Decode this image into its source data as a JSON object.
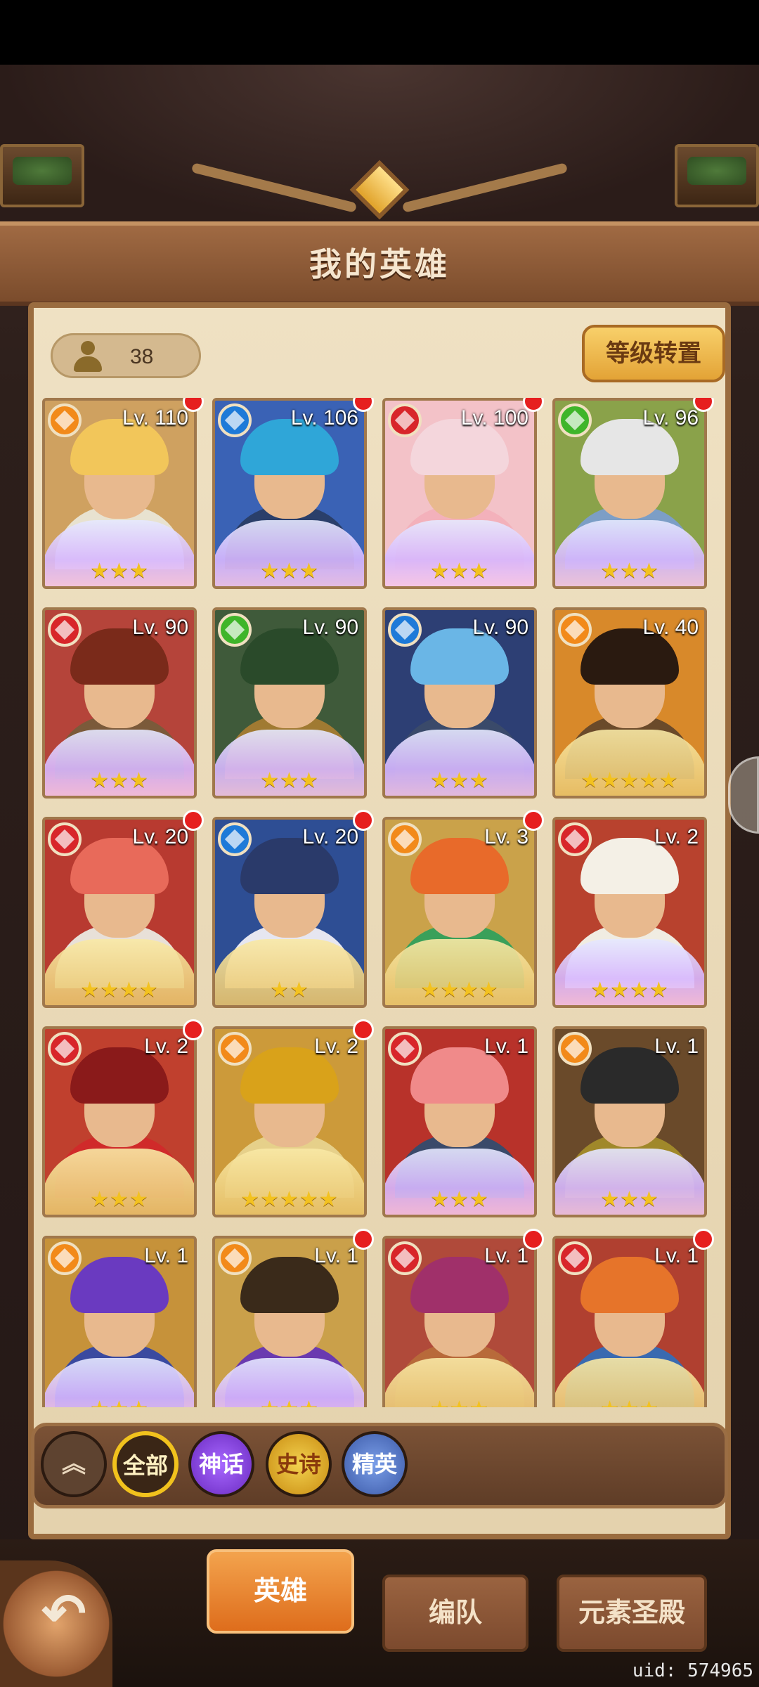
{
  "header": {
    "title": "我的英雄"
  },
  "hero_count": "38",
  "reset_button": "等级转置",
  "colors": {
    "fire": "#d8262a",
    "water": "#1e7ad8",
    "earth": "#f28a1a",
    "wind": "#3fb52a",
    "red_dot": "#e61f1f"
  },
  "heroes": [
    {
      "level": "Lv. 110",
      "stars": "★★★",
      "element": "earth",
      "dot": true,
      "frame": "wings",
      "bg": "#cfa160",
      "hair": "#f2c65a",
      "cloth": "#e8e2d0"
    },
    {
      "level": "Lv. 106",
      "stars": "★★★",
      "element": "water",
      "dot": true,
      "frame": "wings",
      "bg": "#3a62b5",
      "hair": "#2fa6d8",
      "cloth": "#2a3f6a"
    },
    {
      "level": "Lv. 100",
      "stars": "★★★",
      "element": "fire",
      "dot": true,
      "frame": "wings",
      "bg": "#f3c2c8",
      "hair": "#f4d6dc",
      "cloth": "#f3b1bb"
    },
    {
      "level": "Lv. 96",
      "stars": "★★★",
      "element": "wind",
      "dot": true,
      "frame": "wings",
      "bg": "#8aa24a",
      "hair": "#e6e6e6",
      "cloth": "#7c9ec6"
    },
    {
      "level": "Lv. 90",
      "stars": "★★★",
      "element": "fire",
      "dot": false,
      "frame": "wings",
      "bg": "#b5443a",
      "hair": "#7a2a1a",
      "cloth": "#7b5a3a"
    },
    {
      "level": "Lv. 90",
      "stars": "★★★",
      "element": "wind",
      "dot": false,
      "frame": "wings",
      "bg": "#3f5a3a",
      "hair": "#2a4a2a",
      "cloth": "#a07a32"
    },
    {
      "level": "Lv. 90",
      "stars": "★★★",
      "element": "water",
      "dot": false,
      "frame": "wings",
      "bg": "#2d3f74",
      "hair": "#6ab6e6",
      "cloth": "#3a4a6a"
    },
    {
      "level": "Lv. 40",
      "stars": "★★★★★",
      "element": "earth",
      "dot": false,
      "frame": "gold",
      "bg": "#d8892a",
      "hair": "#2a1a10",
      "cloth": "#6a4a2a"
    },
    {
      "level": "Lv. 20",
      "stars": "★★★★",
      "element": "fire",
      "dot": true,
      "frame": "gold",
      "bg": "#b83a30",
      "hair": "#e86a5a",
      "cloth": "#e8e0d8"
    },
    {
      "level": "Lv. 20",
      "stars": "★★",
      "element": "water",
      "dot": true,
      "frame": "gold",
      "bg": "#2e4e94",
      "hair": "#2a3a6a",
      "cloth": "#e6e6f0"
    },
    {
      "level": "Lv. 3",
      "stars": "★★★★",
      "element": "earth",
      "dot": true,
      "frame": "gold",
      "bg": "#caa24a",
      "hair": "#e86a2a",
      "cloth": "#3aa05a"
    },
    {
      "level": "Lv. 2",
      "stars": "★★★★",
      "element": "fire",
      "dot": false,
      "frame": "wings",
      "bg": "#b8422e",
      "hair": "#f4f0e6",
      "cloth": "#f0ece2"
    },
    {
      "level": "Lv. 2",
      "stars": "★★★",
      "element": "fire",
      "dot": true,
      "frame": "gold",
      "bg": "#c0402e",
      "hair": "#8a1a1a",
      "cloth": "#d02a2a"
    },
    {
      "level": "Lv. 2",
      "stars": "★★★★★",
      "element": "earth",
      "dot": true,
      "frame": "gold",
      "bg": "#cc9a3a",
      "hair": "#d9a21a",
      "cloth": "#e6d08a"
    },
    {
      "level": "Lv. 1",
      "stars": "★★★",
      "element": "fire",
      "dot": false,
      "frame": "wings",
      "bg": "#b8322a",
      "hair": "#f08a8a",
      "cloth": "#3a4a6a"
    },
    {
      "level": "Lv. 1",
      "stars": "★★★",
      "element": "earth",
      "dot": false,
      "frame": "wings",
      "bg": "#6a4a2a",
      "hair": "#2a2a2a",
      "cloth": "#a0882a"
    },
    {
      "level": "Lv. 1",
      "stars": "★★★",
      "element": "earth",
      "dot": false,
      "frame": "wings",
      "bg": "#c6923a",
      "hair": "#6a3ac0",
      "cloth": "#3a4aa0"
    },
    {
      "level": "Lv. 1",
      "stars": "★★★",
      "element": "earth",
      "dot": true,
      "frame": "wings",
      "bg": "#caa04a",
      "hair": "#3a2a1a",
      "cloth": "#6a3ab0"
    },
    {
      "level": "Lv. 1",
      "stars": "★★★",
      "element": "fire",
      "dot": true,
      "frame": "gold",
      "bg": "#b04a3a",
      "hair": "#a0306a",
      "cloth": "#b86a3a"
    },
    {
      "level": "Lv. 1",
      "stars": "★★★",
      "element": "fire",
      "dot": true,
      "frame": "gold",
      "bg": "#b04030",
      "hair": "#e6742a",
      "cloth": "#3a6ab0"
    }
  ],
  "filters": {
    "collapse_icon": "double-chevron-up-icon",
    "collapse_glyph": "︽",
    "all": "全部",
    "myth": "神话",
    "epic": "史诗",
    "elite": "精英"
  },
  "tabs": {
    "heroes": "英雄",
    "team": "编队",
    "temple": "元素圣殿"
  },
  "back_glyph": "↶",
  "uid": "uid: 574965"
}
